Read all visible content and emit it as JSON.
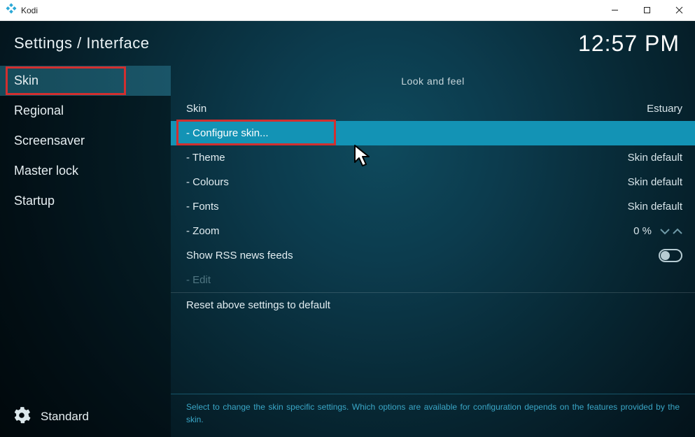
{
  "titlebar": {
    "app_name": "Kodi"
  },
  "header": {
    "breadcrumb": "Settings / Interface",
    "clock": "12:57 PM"
  },
  "sidebar": {
    "items": [
      {
        "label": "Skin",
        "active": true
      },
      {
        "label": "Regional",
        "active": false
      },
      {
        "label": "Screensaver",
        "active": false
      },
      {
        "label": "Master lock",
        "active": false
      },
      {
        "label": "Startup",
        "active": false
      }
    ],
    "level_label": "Standard"
  },
  "main": {
    "section_title": "Look and feel",
    "rows": {
      "skin": {
        "label": "Skin",
        "value": "Estuary"
      },
      "configure": {
        "label": "Configure skin..."
      },
      "theme": {
        "label": "Theme",
        "value": "Skin default"
      },
      "colours": {
        "label": "Colours",
        "value": "Skin default"
      },
      "fonts": {
        "label": "Fonts",
        "value": "Skin default"
      },
      "zoom": {
        "label": "Zoom",
        "value": "0 %"
      },
      "rss": {
        "label": "Show RSS news feeds",
        "on": false
      },
      "edit": {
        "label": "Edit"
      },
      "reset": {
        "label": "Reset above settings to default"
      }
    }
  },
  "footer": {
    "description": "Select to change the skin specific settings. Which options are available for configuration depends on the features provided by the skin."
  }
}
